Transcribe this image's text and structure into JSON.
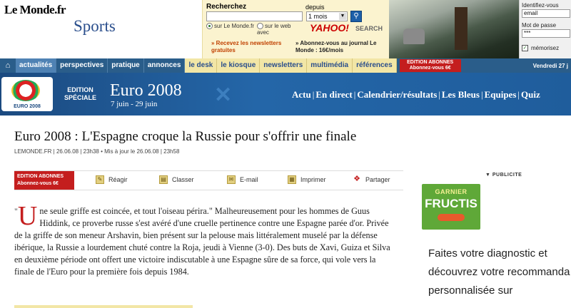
{
  "header": {
    "logo": "Le Monde.fr",
    "section": "Sports",
    "search": {
      "label": "Recherchez",
      "depuis_label": "depuis",
      "query_value": "",
      "period_value": "1 mois",
      "radio_site": "sur Le Monde.fr",
      "radio_web": "sur le web avec",
      "yahoo": "YAHOO!",
      "yahoo_search": "SEARCH",
      "promo_newsletters": "» Recevez les newsletters gratuites",
      "promo_journal": "» Abonnez-vous au journal Le Monde : 16€/mois"
    },
    "login": {
      "identifier_label": "Identifiez-vous",
      "email_value": "email",
      "password_label": "Mot de passe",
      "password_value": "***",
      "remember_label": "mémorisez"
    }
  },
  "nav": {
    "home_icon": "home-icon",
    "items": [
      {
        "label": "actualités",
        "style": "active"
      },
      {
        "label": "perspectives",
        "style": "blue"
      },
      {
        "label": "pratique",
        "style": "blue"
      },
      {
        "label": "annonces",
        "style": "blue"
      },
      {
        "label": "le desk",
        "style": "yellow"
      },
      {
        "label": "le kiosque",
        "style": "yellow"
      },
      {
        "label": "newsletters",
        "style": "yellow"
      },
      {
        "label": "multimédia",
        "style": "yellow"
      },
      {
        "label": "références",
        "style": "yellow"
      }
    ],
    "abonnes_line1": "EDITION ABONNES",
    "abonnes_line2": "Abonnez-vous 6€",
    "date": "Vendredi 27 j"
  },
  "banner": {
    "logo_text": "EURO 2008",
    "edition_line1": "EDITION",
    "edition_line2": "SPÉCIALE",
    "title": "Euro 2008",
    "dates": "7 juin - 29 juin",
    "links": [
      "Actu",
      "En direct",
      "Calendrier/résultats",
      "Les Bleus",
      "Equipes",
      "Quiz"
    ]
  },
  "article": {
    "title": "Euro 2008 : L'Espagne croque la Russie pour s'offrir une finale",
    "meta": "LEMONDE.FR | 26.06.08 | 23h38  •  Mis à jour le 26.06.08 | 23h58",
    "abonnes_line1": "EDITION ABONNES",
    "abonnes_line2": "Abonnez-vous 6€",
    "tools": [
      {
        "label": "Réagir",
        "icon": "comment-icon"
      },
      {
        "label": "Classer",
        "icon": "bookmark-icon"
      },
      {
        "label": "E-mail",
        "icon": "email-icon"
      },
      {
        "label": "Imprimer",
        "icon": "print-icon"
      },
      {
        "label": "Partager",
        "icon": "share-icon"
      }
    ],
    "dropcap": "U",
    "body": "ne seule griffe est coincée, et tout l'oiseau périra.\" Malheureusement pour les hommes de Guus Hiddink, ce proverbe russe s'est avéré d'une cruelle pertinence contre une Espagne parée d'or. Privée de la griffe de son meneur Arshavin, bien présent sur la pelouse mais littéralement muselé par la défense ibérique, la Russie a lourdement chuté contre la Roja, jeudi à Vienne (3-0). Des buts de Xavi, Guiza et Silva en deuxième période ont offert une victoire indiscutable à une Espagne sûre de sa force, qui vole vers la finale de l'Euro pour la première fois depuis 1984."
  },
  "ad": {
    "label": "▼ PUBLICITE",
    "garnier": "GARNIER",
    "brand": "FRUCTIS",
    "line1": "Faites votre diagnostic et",
    "line2": "découvrez votre recommanda",
    "line3": "personnalisée sur"
  }
}
